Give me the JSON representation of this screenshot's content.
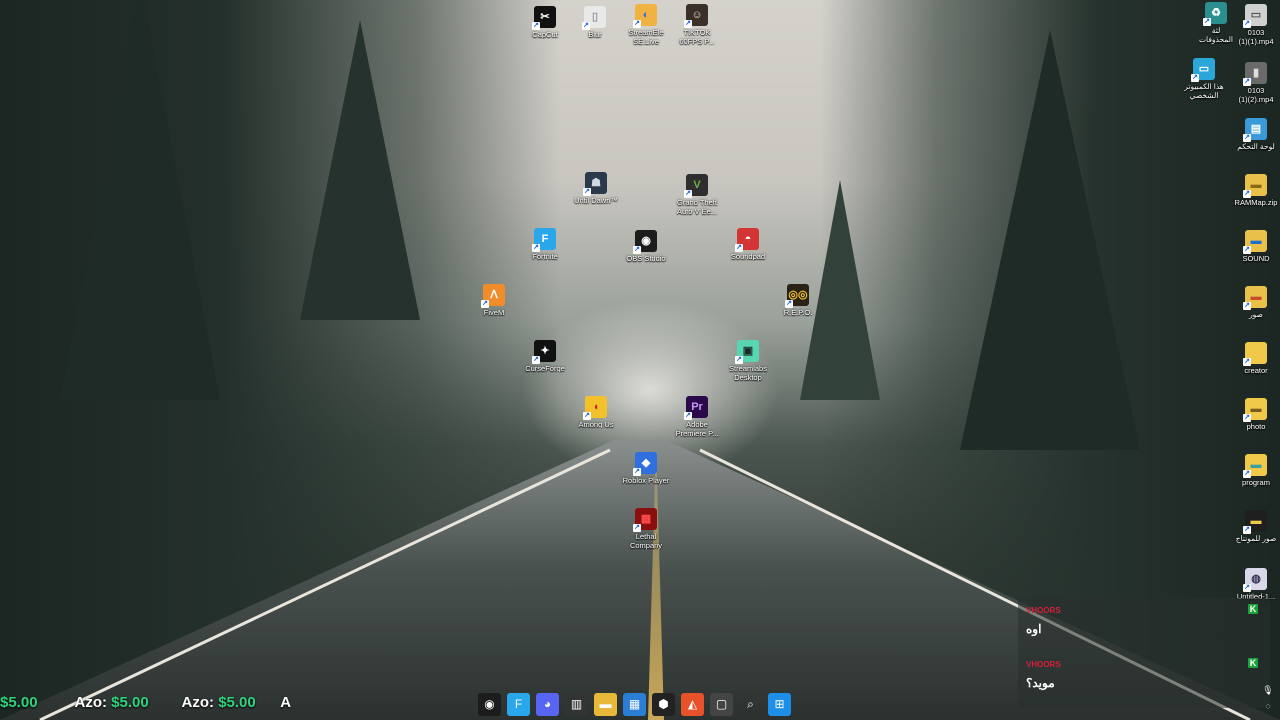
{
  "desktop_icons_center": [
    {
      "label": "CapCut",
      "glyph": "✂",
      "bg": "#111111",
      "fg": "#ffffff"
    },
    {
      "label": "Blur",
      "glyph": "▯",
      "bg": "#e9e9ea",
      "fg": "#999999"
    },
    {
      "label": "StreamEle\nSE.Live",
      "glyph": "◐",
      "bg": "#f0b341",
      "fg": "#3a6fd8"
    },
    {
      "label": "TIKTOK\n60FPS P...",
      "glyph": "☺",
      "bg": "#3b2f2a",
      "fg": "#f1d6c8"
    },
    {
      "label": "Until Dawn™",
      "glyph": "☗",
      "bg": "#2b3a4a",
      "fg": "#d0d8e0"
    },
    {
      "label": "Grand Theft\nAuto V Ee...",
      "glyph": "V",
      "bg": "#2f2f2f",
      "fg": "#6ab04c"
    },
    {
      "label": "Fortnite",
      "glyph": "F",
      "bg": "#2aa7ea",
      "fg": "#ffffff"
    },
    {
      "label": "OBS Studio",
      "glyph": "◉",
      "bg": "#1c1c1c",
      "fg": "#ffffff"
    },
    {
      "label": "Soundpad",
      "glyph": "◓",
      "bg": "#d33434",
      "fg": "#ffffff"
    },
    {
      "label": "FiveM",
      "glyph": "ᐱ",
      "bg": "#f08c2a",
      "fg": "#ffffff"
    },
    {
      "label": "R.E.P.O.",
      "glyph": "◎◎",
      "bg": "#2a2215",
      "fg": "#f2c232"
    },
    {
      "label": "CurseForge",
      "glyph": "✦",
      "bg": "#111111",
      "fg": "#ffffff"
    },
    {
      "label": "Streamlabs\nDesktop",
      "glyph": "▣",
      "bg": "#57d6b2",
      "fg": "#1e2a2a"
    },
    {
      "label": "Among Us",
      "glyph": "◖",
      "bg": "#f3c22b",
      "fg": "#c82020"
    },
    {
      "label": "Adobe\nPremiere P...",
      "glyph": "Pr",
      "bg": "#2a0a4a",
      "fg": "#c79af5"
    },
    {
      "label": "Roblox Player",
      "glyph": "◆",
      "bg": "#2f6fe0",
      "fg": "#ffffff"
    },
    {
      "label": "Lethal\nCompany",
      "glyph": "▦",
      "bg": "#8a1010",
      "fg": "#ff4d4d"
    }
  ],
  "desktop_icons_right": [
    {
      "label": "لثة\nالمحذوفات",
      "glyph": "♻",
      "bg": "#2a8f8f",
      "fg": "#ffffff"
    },
    {
      "label": "0103\n(1)(1).mp4",
      "glyph": "▭",
      "bg": "#d0d0d0",
      "fg": "#555555"
    },
    {
      "label": "هذا الكمبيوتر\nالشخصي",
      "glyph": "▭",
      "bg": "#2aa6d8",
      "fg": "#ffffff"
    },
    {
      "label": "0103\n(1)(2).mp4",
      "glyph": "▮",
      "bg": "#6a6a6a",
      "fg": "#dddddd"
    },
    {
      "label": "لوحة التحكم",
      "glyph": "▤",
      "bg": "#3a9ad8",
      "fg": "#ffffff"
    },
    {
      "label": "RAMMap.zip",
      "glyph": "▬",
      "bg": "#e8c04a",
      "fg": "#8a6a10"
    },
    {
      "label": "SOUND",
      "glyph": "▬",
      "bg": "#e8c04a",
      "fg": "#1e6fd0"
    },
    {
      "label": "صور",
      "glyph": "▬",
      "bg": "#e8c04a",
      "fg": "#c84a30"
    },
    {
      "label": "creator",
      "glyph": "▬",
      "bg": "#f0c84a",
      "fg": "#f0c84a"
    },
    {
      "label": "photo",
      "glyph": "▬",
      "bg": "#f0c84a",
      "fg": "#7a5a20"
    },
    {
      "label": "program",
      "glyph": "▬",
      "bg": "#f0c84a",
      "fg": "#3aa0a0"
    },
    {
      "label": "صور للمونتاج",
      "glyph": "▬",
      "bg": "#1f1f1f",
      "fg": "#f0c84a"
    },
    {
      "label": "Untitled-1...",
      "glyph": "◍",
      "bg": "#d8d8e8",
      "fg": "#333355"
    }
  ],
  "chat": [
    {
      "user": "VHOORS",
      "text": "اوه"
    },
    {
      "user": "VHOORS",
      "text": "مويد؟"
    }
  ],
  "ticker": {
    "items": [
      {
        "name": "",
        "amount": "$5.00"
      },
      {
        "name": "Azo:",
        "amount": "$5.00"
      },
      {
        "name": "Azo:",
        "amount": "$5.00"
      }
    ],
    "tail": "A"
  },
  "taskbar": [
    {
      "icon": "obs-icon",
      "glyph": "◉",
      "bg": "#1c1c1c"
    },
    {
      "icon": "fortnite-icon",
      "glyph": "F",
      "bg": "#2aa7ea"
    },
    {
      "icon": "discord-icon",
      "glyph": "◕",
      "bg": "#5865f2"
    },
    {
      "icon": "voicemod-icon",
      "glyph": "▥",
      "bg": "#333333"
    },
    {
      "icon": "file-explorer-icon",
      "glyph": "▬",
      "bg": "#e8b83a"
    },
    {
      "icon": "microsoft-store-icon",
      "glyph": "▦",
      "bg": "#2a7fd4"
    },
    {
      "icon": "unity-icon",
      "glyph": "⬢",
      "bg": "#222222"
    },
    {
      "icon": "brave-icon",
      "glyph": "◭",
      "bg": "#e8522a"
    },
    {
      "icon": "window-icon",
      "glyph": "▢",
      "bg": "#444444"
    },
    {
      "icon": "search-icon",
      "glyph": "⌕",
      "bg": "transparent"
    },
    {
      "icon": "windows-start-icon",
      "glyph": "⊞",
      "bg": "#1e8fe8"
    }
  ]
}
